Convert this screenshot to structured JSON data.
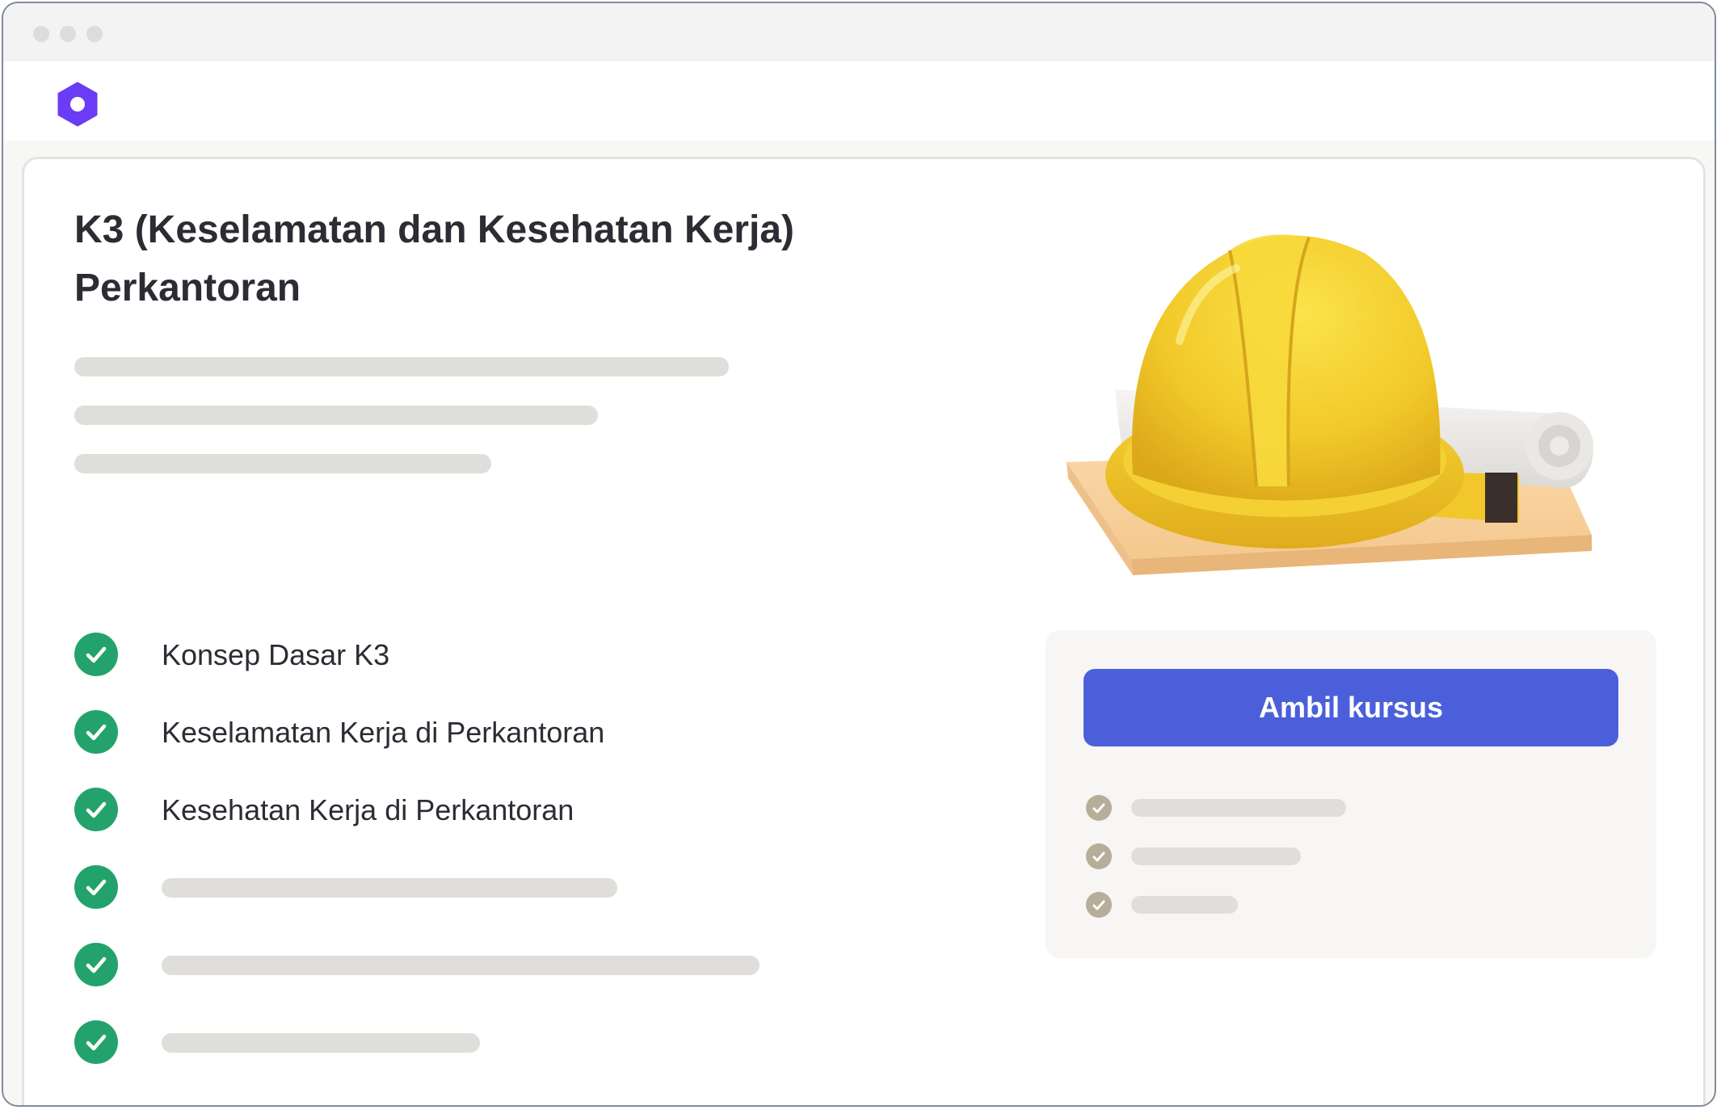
{
  "app": {
    "logo_icon": "hexagon-logo-icon",
    "brand_color": "#6b3cf5"
  },
  "course": {
    "title": "K3 (Keselamatan dan Kesehatan Kerja) Perkantoran",
    "features": [
      "Konsep Dasar K3",
      "Keselamatan Kerja di Perkantoran",
      "Kesehatan Kerja di Perkantoran"
    ],
    "check_icon": "check-circle-icon",
    "check_color": "#23a36b"
  },
  "enroll": {
    "button_label": "Ambil kursus",
    "button_color": "#4b5fdb"
  },
  "illustration": {
    "icon": "hard-hat-blueprint-illustration"
  }
}
